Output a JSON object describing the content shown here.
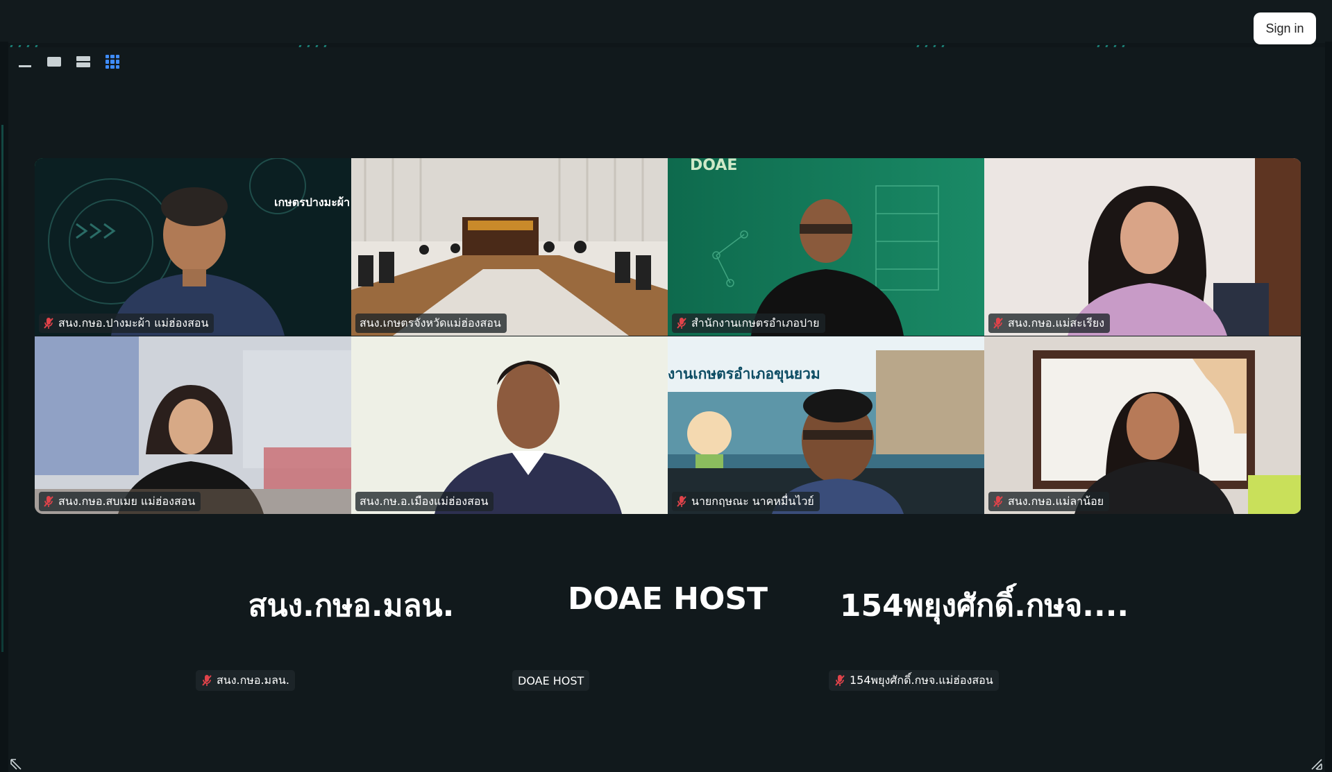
{
  "header": {
    "sign_in_label": "Sign in"
  },
  "toolbar": {
    "buttons": [
      {
        "icon": "minimize-icon"
      },
      {
        "icon": "speaker-view-icon"
      },
      {
        "icon": "strip-view-icon"
      },
      {
        "icon": "gallery-view-icon",
        "active": true
      }
    ]
  },
  "colors": {
    "active_speaker": "#2ed38a",
    "mute": "#e0434a",
    "gallery_active": "#3f8cff"
  },
  "participants": [
    {
      "name": "สนง.กษอ.ปางมะผ้า แม่ฮ่องสอน",
      "muted": true,
      "active": true,
      "background_text": "เกษตรปางมะผ้า"
    },
    {
      "name": "สนง.เกษตรจังหวัดแม่ฮ่องสอน",
      "muted": false
    },
    {
      "name": "สำนักงานเกษตรอำเภอปาย",
      "muted": true,
      "background_text": "DOAE"
    },
    {
      "name": "สนง.กษอ.แม่สะเรียง",
      "muted": true
    },
    {
      "name": "สนง.กษอ.สบเมย แม่ฮ่องสอน",
      "muted": true
    },
    {
      "name": "สนง.กษ.อ.เมืองแม่ฮ่องสอน",
      "muted": false
    },
    {
      "name": "นายกฤษณะ นาคหมื่นไวย์",
      "muted": true,
      "background_text": "งานเกษตรอำเภอขุนยวม"
    },
    {
      "name": "สนง.กษอ.แม่ลาน้อย",
      "muted": true
    }
  ],
  "audio_only": [
    {
      "display": "สนง.กษอ.มลน.",
      "label": "สนง.กษอ.มลน.",
      "muted": true
    },
    {
      "display": "DOAE HOST",
      "label": "DOAE HOST",
      "muted": false
    },
    {
      "display": "154พยุงศักดิ์.กษจ....",
      "label": "154พยุงศักดิ์.กษจ.แม่ฮ่องสอน",
      "muted": true
    }
  ]
}
